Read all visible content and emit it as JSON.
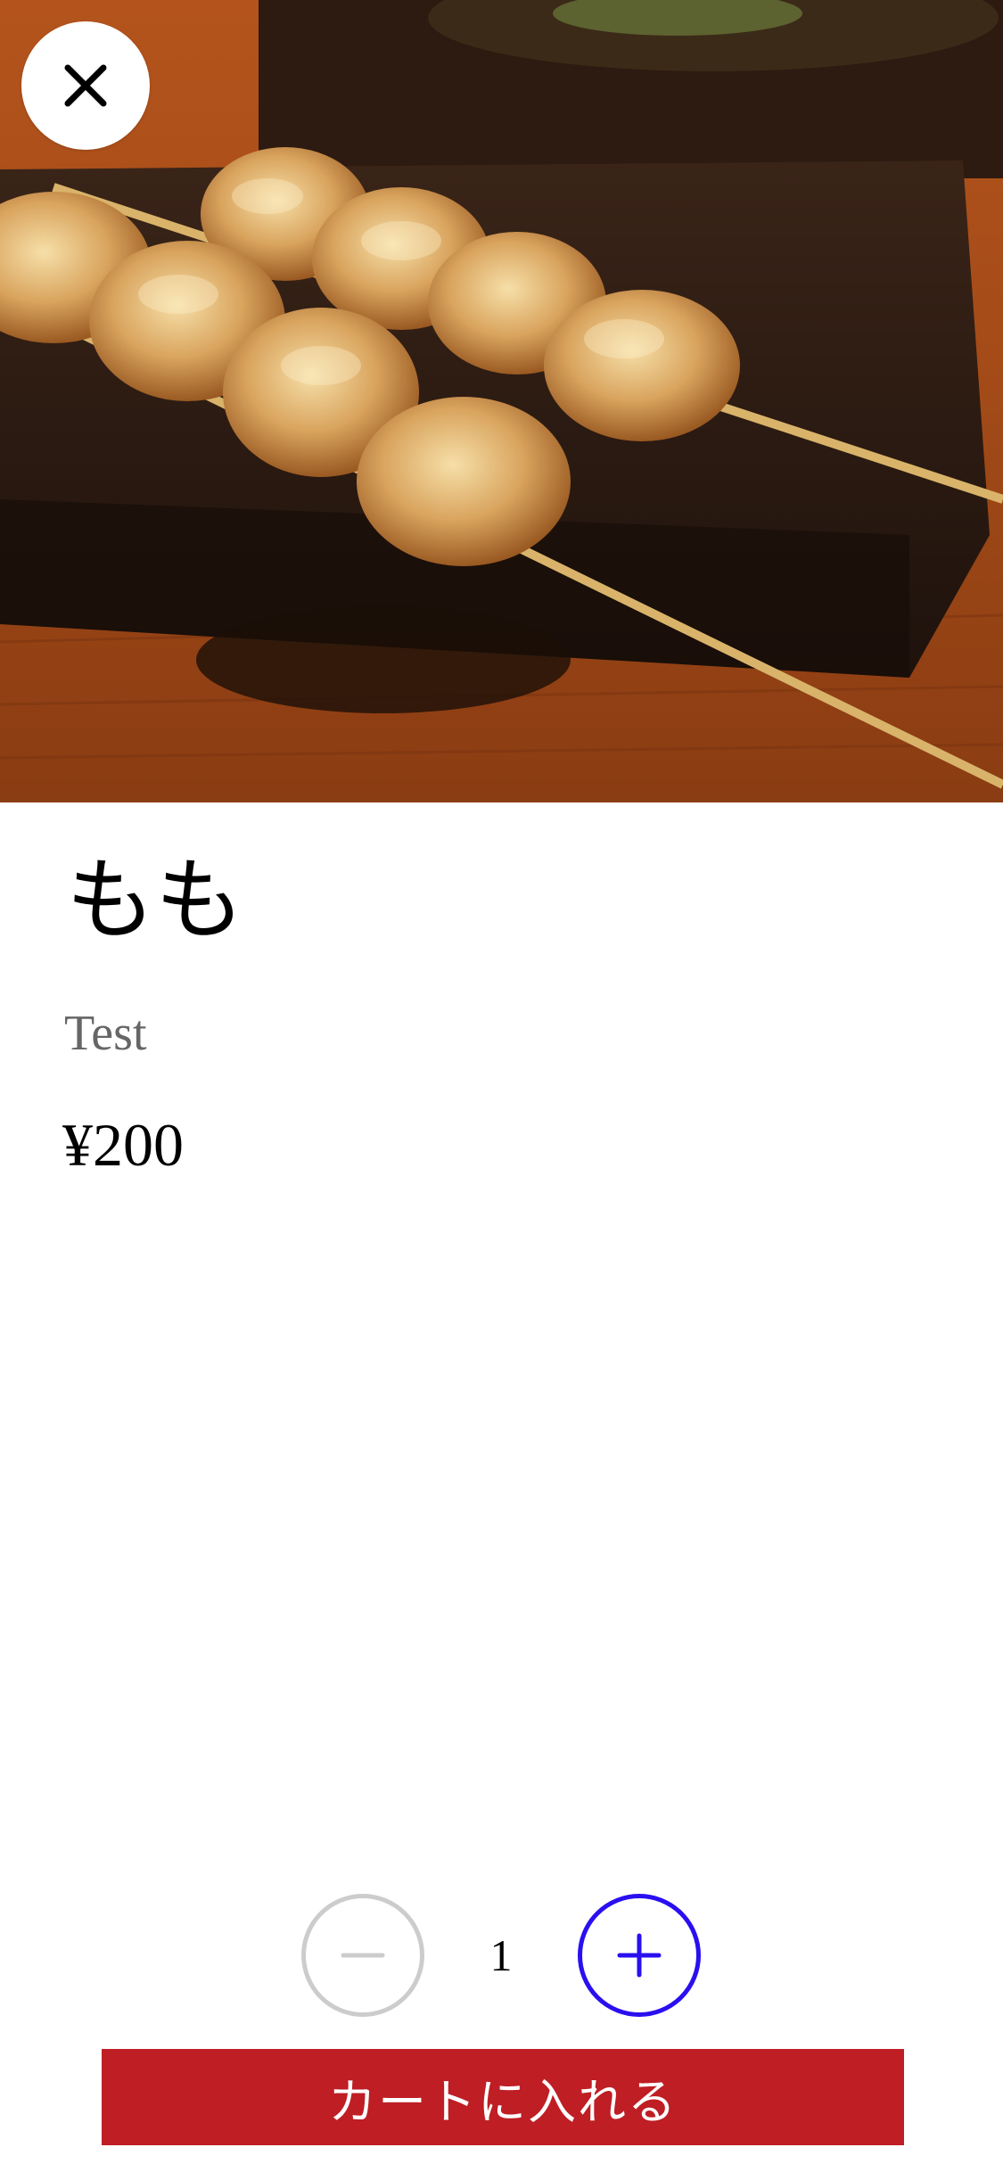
{
  "product": {
    "name": "もも",
    "description": "Test",
    "price": "¥200",
    "image_icon": "grilled-chicken-skewers-photo"
  },
  "header": {
    "close_icon": "close-icon"
  },
  "quantity": {
    "value": "1",
    "decrement_icon": "minus-icon",
    "increment_icon": "plus-icon"
  },
  "actions": {
    "add_to_cart_label": "カートに入れる"
  },
  "colors": {
    "accent_red": "#be1e24",
    "stepper_blue": "#2a0ff0",
    "stepper_disabled": "#cccccc",
    "description_gray": "#666666"
  }
}
